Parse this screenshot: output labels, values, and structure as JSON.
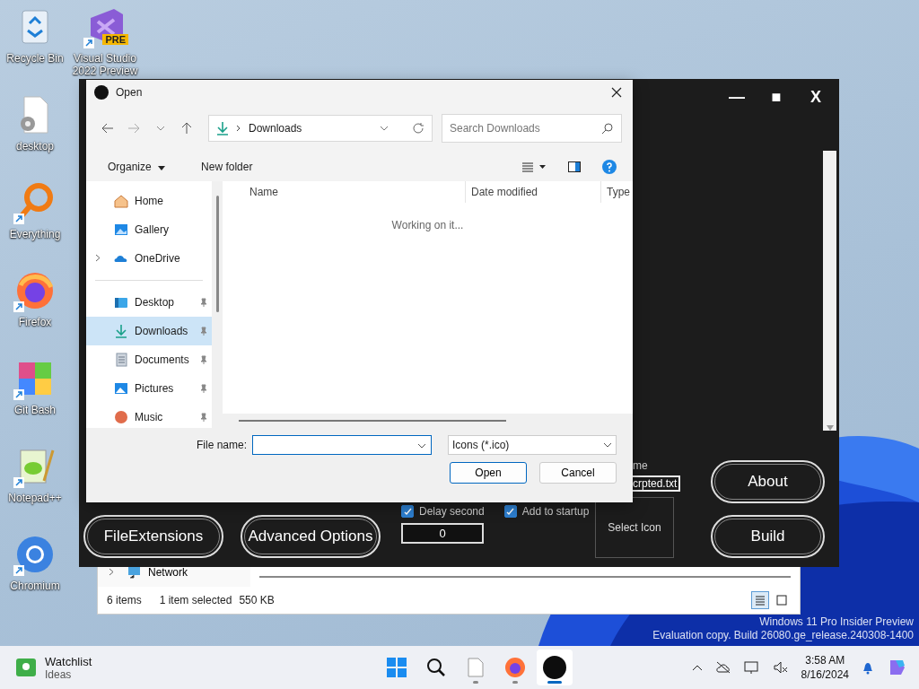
{
  "desktop": {
    "column_1": [
      {
        "kind": "recycle-bin",
        "label": "Recycle Bin",
        "shortcut": false
      },
      {
        "kind": "settings-file",
        "label": "desktop",
        "shortcut": false
      },
      {
        "kind": "everything",
        "label": "Everything",
        "shortcut": true
      },
      {
        "kind": "firefox",
        "label": "Firefox",
        "shortcut": true
      },
      {
        "kind": "git-bash",
        "label": "Git Bash",
        "shortcut": true
      },
      {
        "kind": "notepad",
        "label": "Notepad++",
        "shortcut": true
      },
      {
        "kind": "chromium",
        "label": "Chromium",
        "shortcut": true
      }
    ],
    "column_2": [
      {
        "kind": "visual-studio",
        "label": "Visual Studio 2022 Preview",
        "badge": "PRE",
        "shortcut": true
      }
    ]
  },
  "explorer": {
    "sidebar": [
      {
        "label": "Network",
        "expandable": true
      }
    ],
    "status": {
      "count": "6 items",
      "selection": "1 item selected",
      "size": "550 KB"
    },
    "views": [
      {
        "kind": "details",
        "selected": true
      },
      {
        "kind": "tiles",
        "selected": false
      }
    ]
  },
  "app": {
    "window_controls": [
      "—",
      "■",
      "X"
    ],
    "name_label": "me",
    "name_value": "crpted.txt",
    "buttons": [
      {
        "kind": "file-extensions",
        "label": "FileExtensions"
      },
      {
        "kind": "advanced",
        "label": "Advanced Options"
      },
      {
        "kind": "about",
        "label": "About"
      },
      {
        "kind": "build",
        "label": "Build"
      }
    ],
    "checkboxes": [
      {
        "label": "Delay second",
        "checked": true
      },
      {
        "label": "Add to startup",
        "checked": true
      }
    ],
    "delay_value": "0",
    "select_icon": "Select Icon"
  },
  "dialog": {
    "title": "Open",
    "address": "Downloads",
    "search": {
      "placeholder": "Search Downloads"
    },
    "toolbar": {
      "organize": "Organize",
      "new_folder": "New folder"
    },
    "sidebar": [
      {
        "kind": "home",
        "label": "Home",
        "expandable": false,
        "pinned": false,
        "selected": false
      },
      {
        "kind": "gallery",
        "label": "Gallery",
        "expandable": false,
        "pinned": false,
        "selected": false
      },
      {
        "kind": "onedrive",
        "label": "OneDrive",
        "expandable": true,
        "pinned": false,
        "selected": false
      },
      {
        "kind": "separator"
      },
      {
        "kind": "desktop",
        "label": "Desktop",
        "expandable": false,
        "pinned": true,
        "selected": false
      },
      {
        "kind": "downloads",
        "label": "Downloads",
        "expandable": false,
        "pinned": true,
        "selected": true
      },
      {
        "kind": "documents",
        "label": "Documents",
        "expandable": false,
        "pinned": true,
        "selected": false
      },
      {
        "kind": "pictures",
        "label": "Pictures",
        "expandable": false,
        "pinned": true,
        "selected": false
      },
      {
        "kind": "music",
        "label": "Music",
        "expandable": false,
        "pinned": true,
        "selected": false
      }
    ],
    "columns": [
      "Name",
      "Date modified",
      "Type"
    ],
    "message": "Working on it...",
    "file_name_label": "File name:",
    "file_type": "Icons (*.ico)",
    "buttons": [
      {
        "label": "Open",
        "default": true
      },
      {
        "label": "Cancel",
        "default": false
      }
    ]
  },
  "watermark": [
    "Windows 11 Pro Insider Preview",
    "Evaluation copy. Build 26080.ge_release.240308-1400"
  ],
  "taskbar": {
    "widget": {
      "title": "Watchlist",
      "subtitle": "Ideas"
    },
    "apps": [
      {
        "kind": "start",
        "running": false,
        "active": false
      },
      {
        "kind": "search",
        "running": false,
        "active": false
      },
      {
        "kind": "notepad",
        "running": true,
        "active": false
      },
      {
        "kind": "firefox",
        "running": true,
        "active": false
      },
      {
        "kind": "app",
        "running": true,
        "active": true
      }
    ],
    "time": "3:58 AM",
    "date": "8/16/2024"
  }
}
